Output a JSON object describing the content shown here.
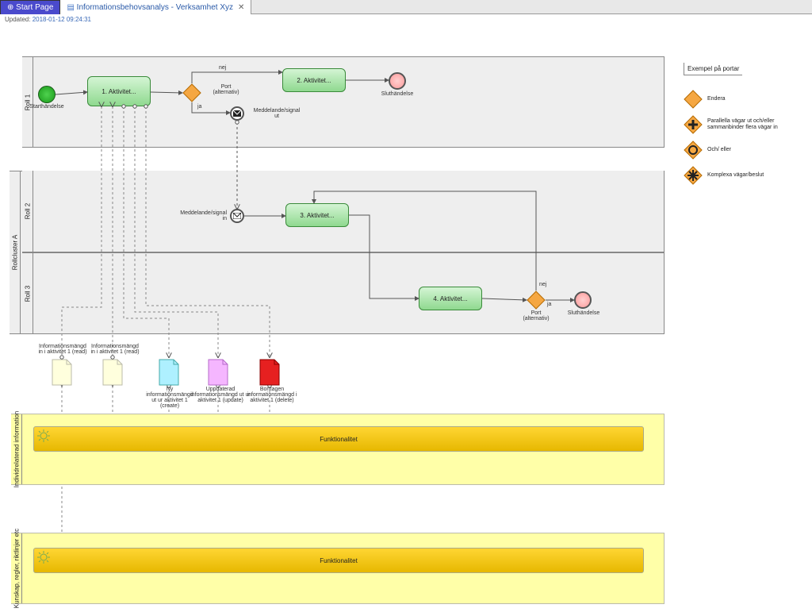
{
  "tabs": {
    "start": "Start Page",
    "doc": "Informationsbehovsanalys - Verksamhet Xyz"
  },
  "updated_label": "Updated:",
  "updated_value": "2018-01-12 09:24:31",
  "lanes": {
    "roll1": "Roll 1",
    "clusterA": "Rollcluster A",
    "roll2": "Roll 2",
    "roll3": "Roll 3",
    "info_lane": "Individrelaterad information",
    "rules_lane": "Kunskap, regler, riktlinjer etc"
  },
  "nodes": {
    "start1": "Starthändelse",
    "act1": "1. Aktivitet...",
    "gate1": "Port\n(alternativ)",
    "nej": "nej",
    "ja": "ja",
    "act2": "2. Aktivitet...",
    "end1": "Sluthändelse",
    "msg_out": "Meddelande/signal\nut",
    "msg_in": "Meddelande/signal\nin",
    "act3": "3. Aktivitet...",
    "act4": "4. Aktivitet...",
    "gate2": "Port\n(alternativ)",
    "end2": "Sluthändelse"
  },
  "docs": {
    "read1": "Informationsmängd\nin i aktivitet 1 (read)",
    "read2": "Informationsmängd\nin i aktivitet 1 (read)",
    "create": "Ny\ninformationsmängd\nut ur aktivitet 1\n(create)",
    "update": "Uppdaterad\ninformationsmängd ut ur\naktivitet 1 (update)",
    "delete": "Borttagen\ninformationsmängd i\naktivitet 1 (delete)"
  },
  "func": "Funktionalitet",
  "legend": {
    "title": "Exempel på portar",
    "either": "Endera",
    "parallel": "Parallella vägar ut och/eller sammanbinder flera vägar in",
    "andor": "Och/ eller",
    "complex": "Komplexa vägar/beslut"
  }
}
